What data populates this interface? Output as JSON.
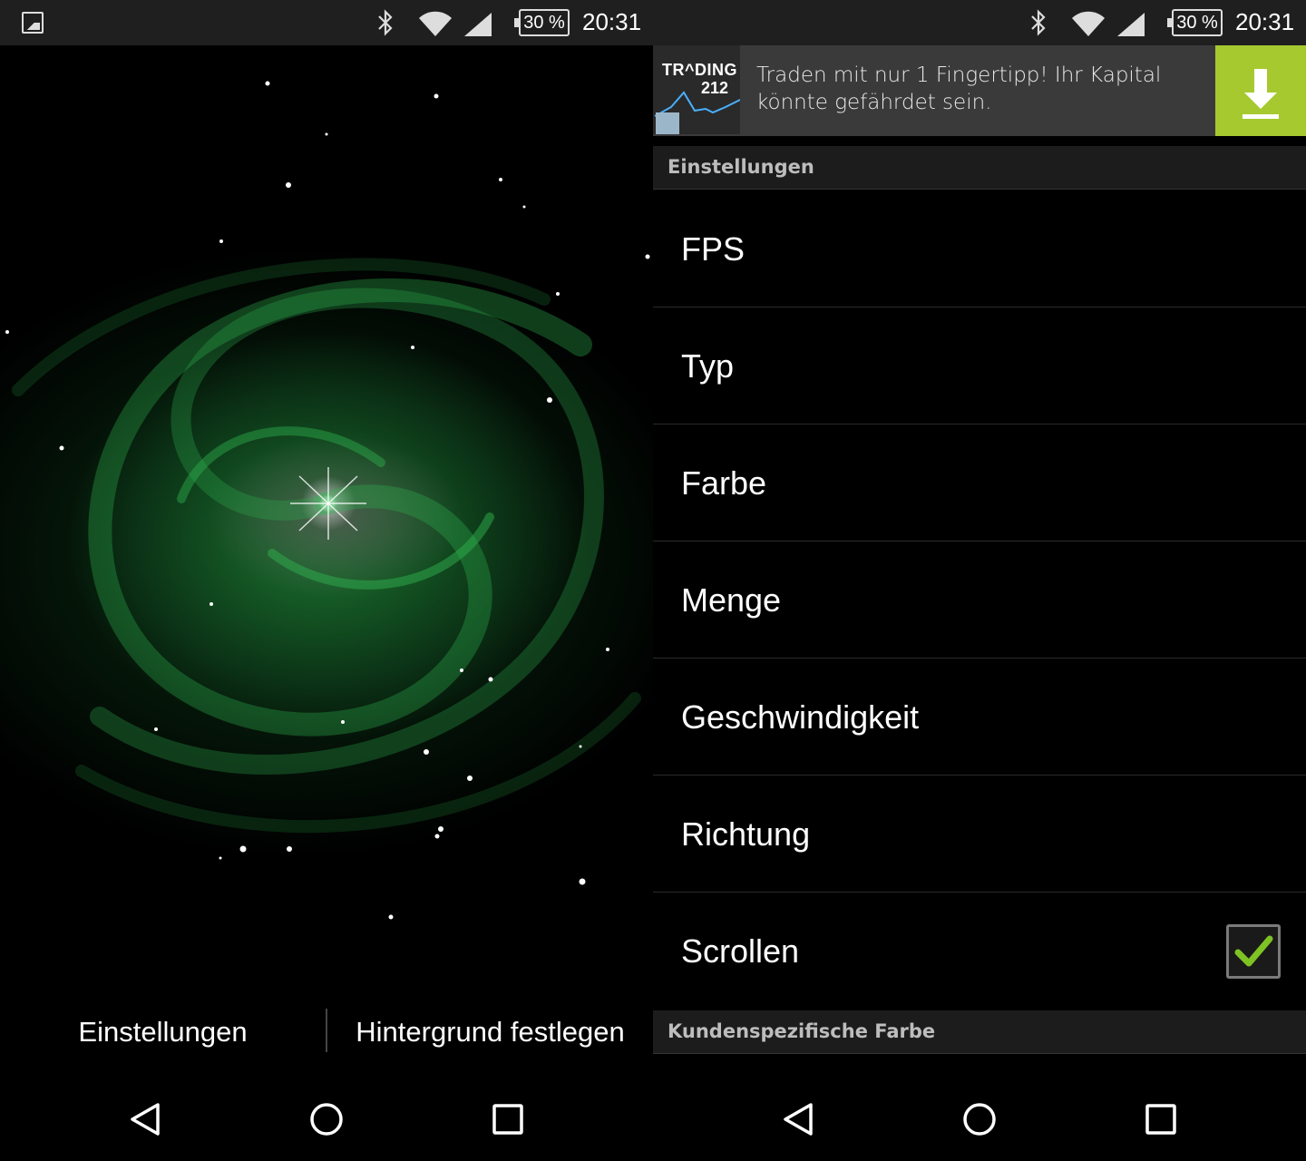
{
  "status_bar": {
    "battery": "30 %",
    "time": "20:31"
  },
  "left": {
    "wallpaper": {
      "color": "#2db24a",
      "description_icon": "galaxy-wallpaper"
    },
    "actions": {
      "settings_label": "Einstellungen",
      "set_wallpaper_label": "Hintergrund festlegen"
    }
  },
  "right": {
    "ad": {
      "brand_line1": "TR^DING",
      "brand_line2": "212",
      "text": "Traden mit nur 1 Fingertipp! Ihr Kapital könnte gefährdet sein.",
      "button_color": "#a5c92f"
    },
    "sections": [
      {
        "title": "Einstellungen"
      },
      {
        "title": "Kundenspezifische Farbe"
      }
    ],
    "prefs": [
      {
        "label": "FPS"
      },
      {
        "label": "Typ"
      },
      {
        "label": "Farbe"
      },
      {
        "label": "Menge"
      },
      {
        "label": "Geschwindigkeit"
      },
      {
        "label": "Richtung"
      },
      {
        "label": "Scrollen",
        "checked": true
      }
    ]
  },
  "nav": {
    "icons": [
      "back-icon",
      "home-icon",
      "recents-icon"
    ]
  }
}
